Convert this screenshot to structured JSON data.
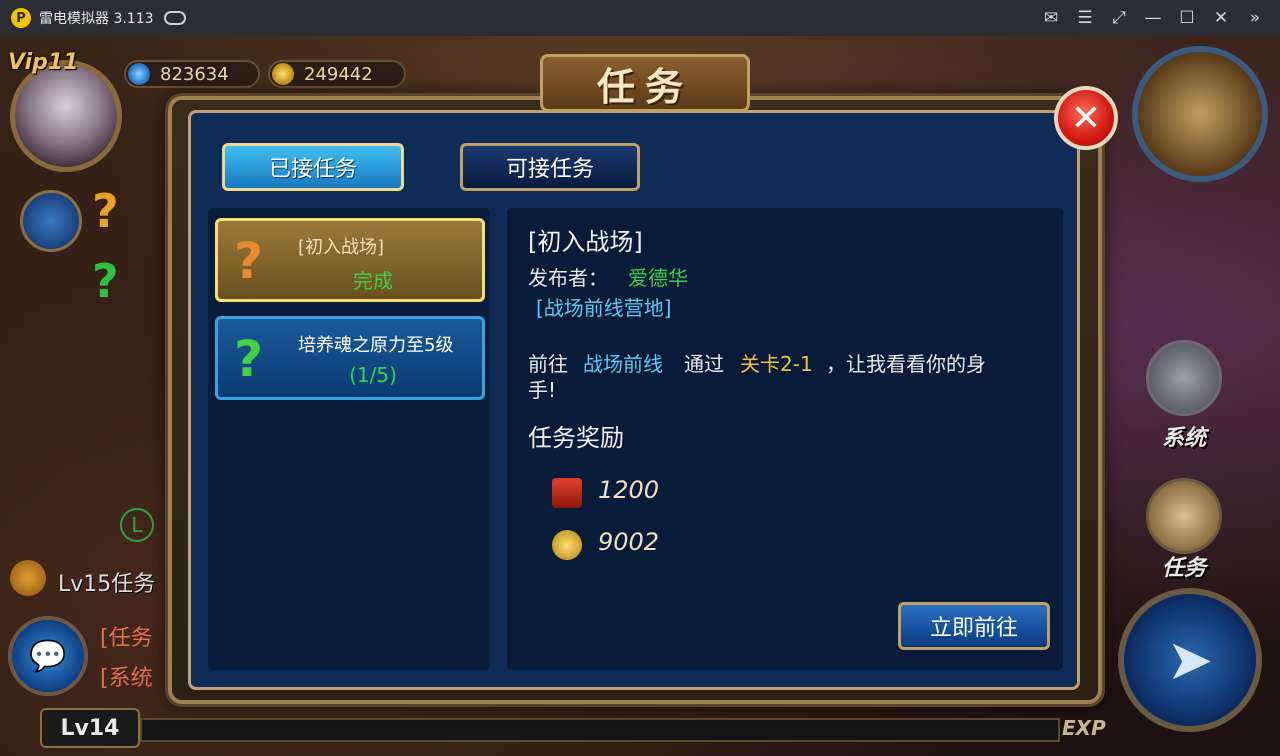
{
  "window": {
    "title": "雷电模拟器 3.113",
    "logo_glyph": "P",
    "controls": [
      "mail-icon",
      "menu-icon",
      "fullscreen-icon",
      "minimize-icon",
      "maximize-icon",
      "close-icon",
      "expand-icon"
    ]
  },
  "hud": {
    "vip": "Vip11",
    "gems": "823634",
    "coins": "249442",
    "level": "Lv14",
    "exp_label": "EXP",
    "quest_hint": "Lv15任务",
    "chat_lines": [
      "[任务",
      "[系统"
    ],
    "side_labels": [
      "系统",
      "任务"
    ]
  },
  "panel": {
    "title": "任务",
    "tabs": {
      "accepted": "已接任务",
      "available": "可接任务"
    },
    "quests": [
      {
        "name": "[初入战场]",
        "status": "完成",
        "icon": "?"
      },
      {
        "name": "培养魂之原力至5级",
        "status": "(1/5)",
        "icon": "?"
      }
    ],
    "detail": {
      "title": "[初入战场]",
      "publisher_label": "发布者：",
      "publisher": "爱德华",
      "location": "[战场前线营地]",
      "desc_prefix": "前往",
      "desc_place": "战场前线",
      "desc_mid": "通过",
      "desc_stage": "关卡2-1",
      "desc_suffix": "，让我看看你的身",
      "desc_line2": "手!",
      "reward_heading": "任务奖励",
      "rewards": [
        {
          "type": "exp-icon",
          "value": "1200"
        },
        {
          "type": "coin-icon",
          "value": "9002"
        }
      ]
    },
    "go_button": "立即前往"
  },
  "colors": {
    "panel_blue": "#0f2c56",
    "gold_border": "#c0a070",
    "green_text": "#3ad04a",
    "cyan_text": "#60c8f0",
    "yellow_text": "#f0c040"
  }
}
